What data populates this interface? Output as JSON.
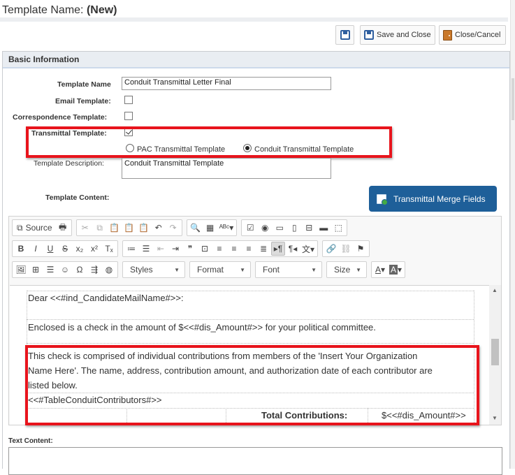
{
  "page": {
    "title_prefix": "Template Name:",
    "title_value": "(New)"
  },
  "toolbar": {
    "save_close": "Save and Close",
    "close_cancel": "Close/Cancel"
  },
  "section": {
    "title": "Basic Information"
  },
  "form": {
    "template_name_label": "Template Name",
    "template_name_value": "Conduit Transmittal Letter Final",
    "email_template_label": "Email Template:",
    "correspondence_template_label": "Correspondence Template:",
    "transmittal_template_label": "Transmittal Template:",
    "pac_option": "PAC Transmittal Template",
    "conduit_option": "Conduit Transmittal Template",
    "description_label": "Template Description:",
    "description_value": "Conduit Transmittal Template",
    "content_label": "Template Content:",
    "merge_fields_button": "Transmittal Merge Fields",
    "text_content_label": "Text Content:"
  },
  "editor": {
    "source_label": "Source",
    "styles_label": "Styles",
    "format_label": "Format",
    "font_label": "Font",
    "size_label": "Size",
    "lines": {
      "greeting": "Dear <<#ind_CandidateMailName#>>:",
      "enclosed": "Enclosed is a check in the amount of $<<#dis_Amount#>> for your political committee.",
      "para1": "This check is comprised of individual contributions from members of the 'Insert Your Organization",
      "para2": "Name Here'. The name, address, contribution amount, and authorization date of each contributor are",
      "para3": "listed below.",
      "table_token": "<<#TableConduitContributors#>>",
      "total_label": "Total Contributions:",
      "total_value": "$<<#dis_Amount#>>"
    }
  },
  "colors": {
    "accent": "#1e5f99",
    "highlight": "#e8141c"
  }
}
